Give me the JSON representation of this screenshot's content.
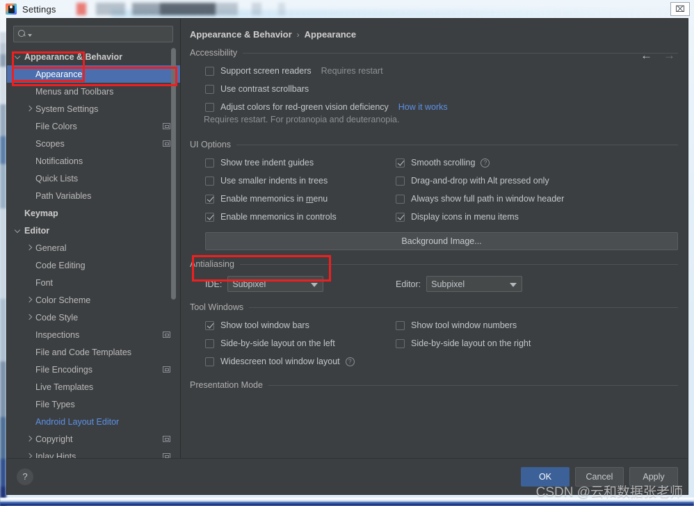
{
  "window": {
    "title": "Settings",
    "app_icon": "intellij-idea-icon",
    "close_label": "⌧"
  },
  "search": {
    "value": "",
    "placeholder": "",
    "icon": "search-icon"
  },
  "sidebar": {
    "items": [
      {
        "label": "Appearance & Behavior",
        "indent": 0,
        "arrow": "down",
        "bold": true,
        "selected": false,
        "link": false,
        "config_icon": false
      },
      {
        "label": "Appearance",
        "indent": 1,
        "arrow": "none",
        "bold": false,
        "selected": true,
        "link": false,
        "config_icon": false
      },
      {
        "label": "Menus and Toolbars",
        "indent": 1,
        "arrow": "none",
        "bold": false,
        "selected": false,
        "link": false,
        "config_icon": false
      },
      {
        "label": "System Settings",
        "indent": 1,
        "arrow": "right",
        "bold": false,
        "selected": false,
        "link": false,
        "config_icon": false
      },
      {
        "label": "File Colors",
        "indent": 1,
        "arrow": "none",
        "bold": false,
        "selected": false,
        "link": false,
        "config_icon": true
      },
      {
        "label": "Scopes",
        "indent": 1,
        "arrow": "none",
        "bold": false,
        "selected": false,
        "link": false,
        "config_icon": true
      },
      {
        "label": "Notifications",
        "indent": 1,
        "arrow": "none",
        "bold": false,
        "selected": false,
        "link": false,
        "config_icon": false
      },
      {
        "label": "Quick Lists",
        "indent": 1,
        "arrow": "none",
        "bold": false,
        "selected": false,
        "link": false,
        "config_icon": false
      },
      {
        "label": "Path Variables",
        "indent": 1,
        "arrow": "none",
        "bold": false,
        "selected": false,
        "link": false,
        "config_icon": false
      },
      {
        "label": "Keymap",
        "indent": 0,
        "arrow": "none",
        "bold": true,
        "selected": false,
        "link": false,
        "config_icon": false
      },
      {
        "label": "Editor",
        "indent": 0,
        "arrow": "down",
        "bold": true,
        "selected": false,
        "link": false,
        "config_icon": false
      },
      {
        "label": "General",
        "indent": 1,
        "arrow": "right",
        "bold": false,
        "selected": false,
        "link": false,
        "config_icon": false
      },
      {
        "label": "Code Editing",
        "indent": 1,
        "arrow": "none",
        "bold": false,
        "selected": false,
        "link": false,
        "config_icon": false
      },
      {
        "label": "Font",
        "indent": 1,
        "arrow": "none",
        "bold": false,
        "selected": false,
        "link": false,
        "config_icon": false
      },
      {
        "label": "Color Scheme",
        "indent": 1,
        "arrow": "right",
        "bold": false,
        "selected": false,
        "link": false,
        "config_icon": false
      },
      {
        "label": "Code Style",
        "indent": 1,
        "arrow": "right",
        "bold": false,
        "selected": false,
        "link": false,
        "config_icon": false
      },
      {
        "label": "Inspections",
        "indent": 1,
        "arrow": "none",
        "bold": false,
        "selected": false,
        "link": false,
        "config_icon": true
      },
      {
        "label": "File and Code Templates",
        "indent": 1,
        "arrow": "none",
        "bold": false,
        "selected": false,
        "link": false,
        "config_icon": false
      },
      {
        "label": "File Encodings",
        "indent": 1,
        "arrow": "none",
        "bold": false,
        "selected": false,
        "link": false,
        "config_icon": true
      },
      {
        "label": "Live Templates",
        "indent": 1,
        "arrow": "none",
        "bold": false,
        "selected": false,
        "link": false,
        "config_icon": false
      },
      {
        "label": "File Types",
        "indent": 1,
        "arrow": "none",
        "bold": false,
        "selected": false,
        "link": false,
        "config_icon": false
      },
      {
        "label": "Android Layout Editor",
        "indent": 1,
        "arrow": "none",
        "bold": false,
        "selected": false,
        "link": true,
        "config_icon": false
      },
      {
        "label": "Copyright",
        "indent": 1,
        "arrow": "right",
        "bold": false,
        "selected": false,
        "link": false,
        "config_icon": true
      },
      {
        "label": "Inlay Hints",
        "indent": 1,
        "arrow": "right",
        "bold": false,
        "selected": false,
        "link": false,
        "config_icon": true
      }
    ]
  },
  "breadcrumb": {
    "parent": "Appearance & Behavior",
    "separator": "›",
    "current": "Appearance"
  },
  "nav": {
    "back_icon": "arrow-left-icon",
    "forward_icon": "arrow-right-icon",
    "back": "←",
    "forward": "→"
  },
  "sections": {
    "accessibility": {
      "title": "Accessibility",
      "rows": [
        {
          "label": "Support screen readers",
          "checked": false,
          "note": "Requires restart",
          "link": "",
          "help": false
        },
        {
          "label": "Use contrast scrollbars",
          "checked": false,
          "note": "",
          "link": "",
          "help": false
        },
        {
          "label": "Adjust colors for red-green vision deficiency",
          "checked": false,
          "note": "",
          "link": "How it works",
          "help": false
        }
      ],
      "subnote": "Requires restart. For protanopia and deuteranopia."
    },
    "ui_options": {
      "title": "UI Options",
      "left_rows": [
        {
          "label": "Show tree indent guides",
          "checked": false,
          "mnemonic": "",
          "help": false
        },
        {
          "label": "Use smaller indents in trees",
          "checked": false,
          "mnemonic": "",
          "help": false
        },
        {
          "label": "Enable mnemonics in menu",
          "checked": true,
          "mnemonic": "m",
          "help": false
        },
        {
          "label": "Enable mnemonics in controls",
          "checked": true,
          "mnemonic": "",
          "help": false
        }
      ],
      "right_rows": [
        {
          "label": "Smooth scrolling",
          "checked": true,
          "help": true
        },
        {
          "label": "Drag-and-drop with Alt pressed only",
          "checked": false,
          "help": false
        },
        {
          "label": "Always show full path in window header",
          "checked": false,
          "help": false
        },
        {
          "label": "Display icons in menu items",
          "checked": true,
          "help": false
        }
      ],
      "background_image_button": "Background Image..."
    },
    "antialiasing": {
      "title": "Antialiasing",
      "ide_label": "IDE:",
      "ide_value": "Subpixel",
      "editor_label": "Editor:",
      "editor_value": "Subpixel"
    },
    "tool_windows": {
      "title": "Tool Windows",
      "left_rows": [
        {
          "label": "Show tool window bars",
          "checked": true,
          "help": false
        },
        {
          "label": "Side-by-side layout on the left",
          "checked": false,
          "help": false
        },
        {
          "label": "Widescreen tool window layout",
          "checked": false,
          "help": true
        }
      ],
      "right_rows": [
        {
          "label": "Show tool window numbers",
          "checked": false,
          "help": false
        },
        {
          "label": "Side-by-side layout on the right",
          "checked": false,
          "help": false
        }
      ]
    },
    "presentation_mode": {
      "title": "Presentation Mode"
    }
  },
  "footer": {
    "help_label": "?",
    "ok": "OK",
    "cancel": "Cancel",
    "apply": "Apply"
  },
  "watermark": {
    "text": "CSDN @云和数据张老师"
  },
  "annotations": {
    "color": "#f01f1f",
    "boxes": [
      "sidebar-appearance-behavior",
      "sidebar-appearance-row",
      "background-image-button"
    ]
  }
}
